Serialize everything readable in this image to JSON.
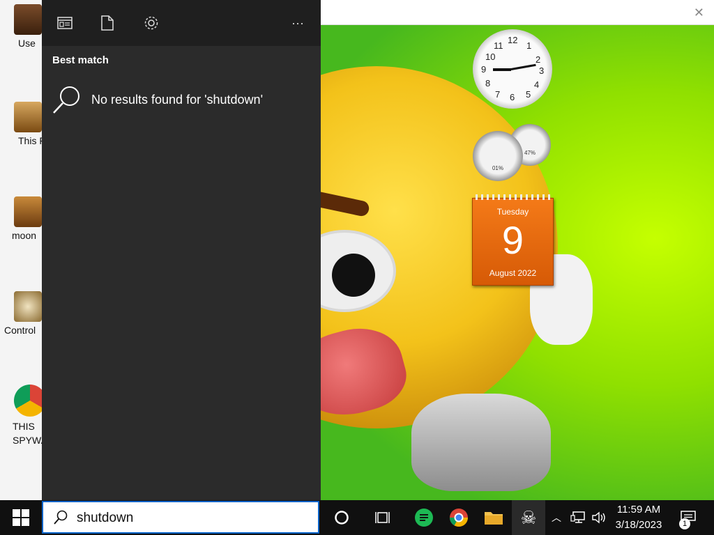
{
  "desktop": {
    "icons": [
      {
        "label": "Use"
      },
      {
        "label": "This F"
      },
      {
        "label": "moon"
      },
      {
        "label": "Control"
      },
      {
        "label": "THIS SPYWA"
      }
    ]
  },
  "gadgets": {
    "clock": {
      "numbers": [
        "12",
        "1",
        "2",
        "3",
        "4",
        "5",
        "6",
        "7",
        "8",
        "9",
        "10",
        "11"
      ]
    },
    "meter_big": "01%",
    "meter_small": "47%",
    "calendar": {
      "day_of_week": "Tuesday",
      "day": "9",
      "month_year": "August 2022"
    }
  },
  "search_panel": {
    "toolbar_icons": [
      "apps-icon",
      "documents-icon",
      "settings-icon",
      "more-icon"
    ],
    "more_label": "···",
    "best_match_label": "Best match",
    "no_results_text": "No results found for 'shutdown'"
  },
  "taskbar": {
    "search_value": "shutdown",
    "time": "11:59 AM",
    "date": "3/18/2023",
    "notification_count": "1",
    "colors": {
      "accent": "#0a63c9",
      "taskbar_bg": "#101010"
    }
  }
}
